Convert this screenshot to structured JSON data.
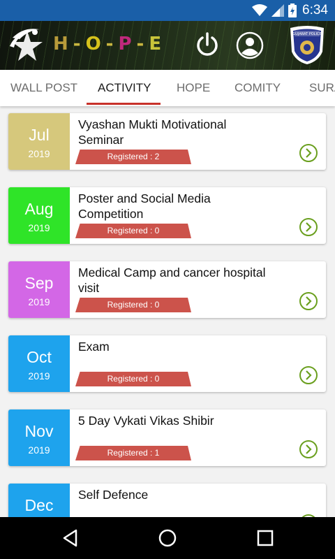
{
  "status": {
    "time": "6:34",
    "icons": [
      "wifi-icon",
      "cell-signal-icon",
      "battery-icon"
    ]
  },
  "header": {
    "logo_icon": "hope-star-logo-icon",
    "title_letters": [
      {
        "ch": "H",
        "color": "#b89b3a"
      },
      {
        "ch": "-",
        "color": "#c9b640"
      },
      {
        "ch": "O",
        "color": "#d6c21c"
      },
      {
        "ch": "-",
        "color": "#c9b640"
      },
      {
        "ch": "P",
        "color": "#c0297c"
      },
      {
        "ch": "-",
        "color": "#c9b640"
      },
      {
        "ch": "E",
        "color": "#c8c43a"
      }
    ],
    "power_icon": "power-icon",
    "profile_icon": "profile-icon",
    "badge_text": "GUJARAT POLICE"
  },
  "tabs": [
    {
      "label": "WALL POST",
      "active": false
    },
    {
      "label": "ACTIVITY",
      "active": true
    },
    {
      "label": "HOPE",
      "active": false
    },
    {
      "label": "COMITY",
      "active": false
    },
    {
      "label": "SURA",
      "active": false
    }
  ],
  "activities": [
    {
      "month": "Jul",
      "year": "2019",
      "color": "#d6c87c",
      "title": "Vyashan Mukti Motivational Seminar",
      "registered": "Registered : 2"
    },
    {
      "month": "Aug",
      "year": "2019",
      "color": "#2fe428",
      "title": "Poster and Social Media Competition",
      "registered": "Registered : 0"
    },
    {
      "month": "Sep",
      "year": "2019",
      "color": "#d367e6",
      "title": "Medical Camp and cancer hospital visit",
      "registered": "Registered : 0"
    },
    {
      "month": "Oct",
      "year": "2019",
      "color": "#1ea3ed",
      "title": "Exam",
      "registered": "Registered : 0"
    },
    {
      "month": "Nov",
      "year": "2019",
      "color": "#1ea3ed",
      "title": "5 Day Vykati Vikas Shibir",
      "registered": "Registered : 1"
    },
    {
      "month": "Dec",
      "year": "",
      "color": "#1ea3ed",
      "title": "Self Defence",
      "registered": ""
    }
  ],
  "colors": {
    "status_bar": "#1a5fa8",
    "accent": "#c8312a",
    "chevron": "#6a9f1e",
    "ribbon": "#cc534b"
  },
  "nav": {
    "icons": [
      "back-icon",
      "home-icon",
      "recents-icon"
    ]
  }
}
